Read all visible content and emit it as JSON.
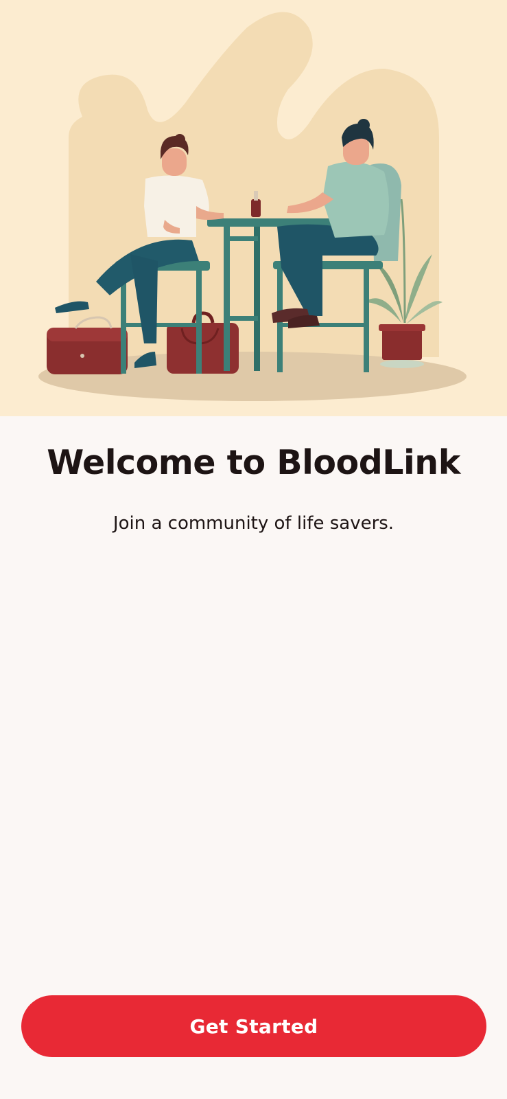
{
  "welcome": {
    "title": "Welcome to BloodLink",
    "subtitle": "Join a community of life savers.",
    "cta_label": "Get Started"
  },
  "colors": {
    "background": "#fbf7f5",
    "hero_background": "#fcecd0",
    "primary": "#e82935",
    "text": "#1d1414"
  },
  "illustration": {
    "subject": "two people seated at a table during blood donation",
    "icon": "blood-donation-illustration"
  }
}
